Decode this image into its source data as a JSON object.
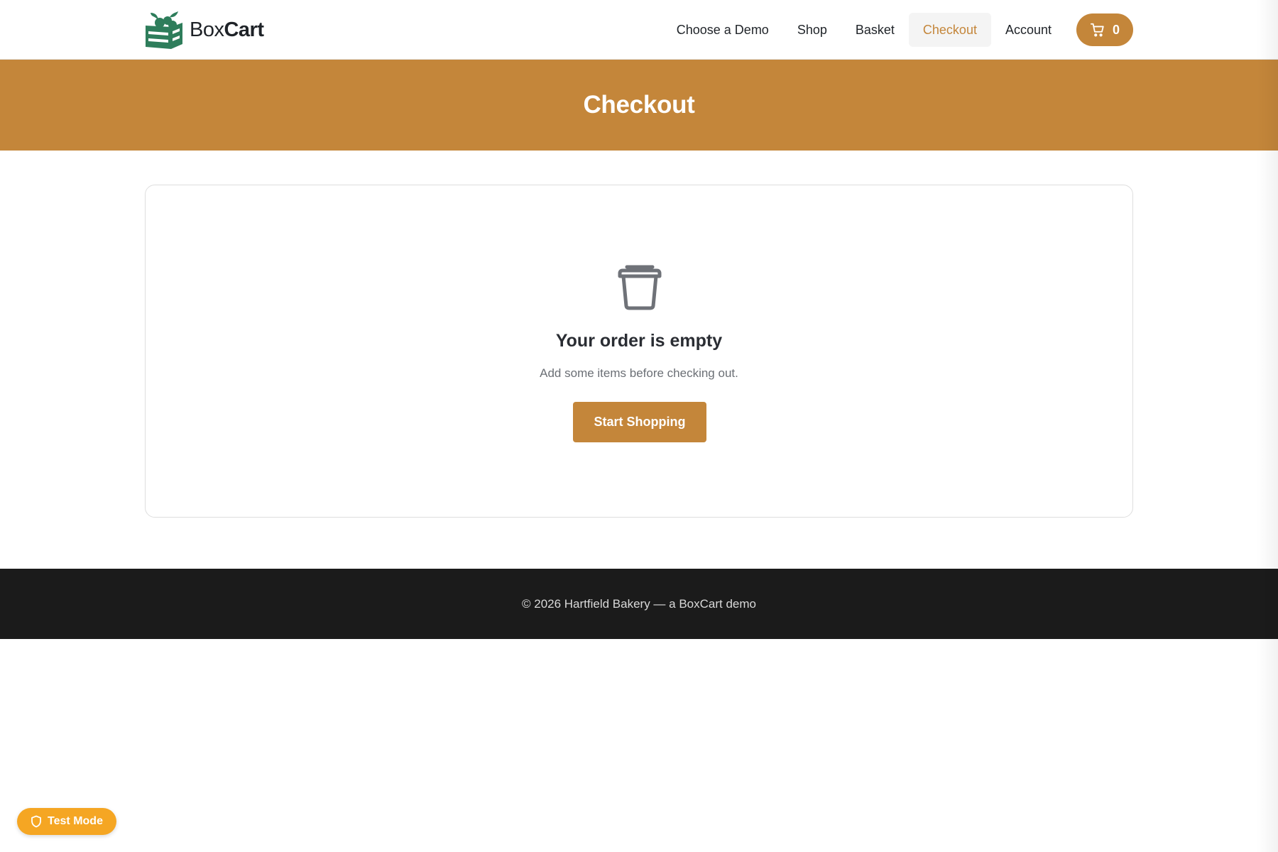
{
  "brand": {
    "name_light": "Box",
    "name_bold": "Cart",
    "logo_icon": "produce-crate-icon",
    "logo_color": "#2e7d5b"
  },
  "nav": {
    "items": [
      {
        "label": "Choose a Demo",
        "active": false
      },
      {
        "label": "Shop",
        "active": false
      },
      {
        "label": "Basket",
        "active": false
      },
      {
        "label": "Checkout",
        "active": true
      },
      {
        "label": "Account",
        "active": false
      }
    ],
    "cart": {
      "icon": "cart-icon",
      "count": "0"
    }
  },
  "hero": {
    "title": "Checkout"
  },
  "empty_state": {
    "icon": "empty-bin-icon",
    "title": "Your order is empty",
    "subtitle": "Add some items before checking out.",
    "button_label": "Start Shopping"
  },
  "footer": {
    "text": "© 2026 Hartfield Bakery — a BoxCart demo"
  },
  "test_mode": {
    "icon": "shield-icon",
    "label": "Test Mode"
  },
  "colors": {
    "accent": "#c4863a",
    "footer_bg": "#1b1b1b",
    "badge": "#f5a623",
    "text_dark": "#1f2328",
    "text_muted": "#6b6f75"
  }
}
